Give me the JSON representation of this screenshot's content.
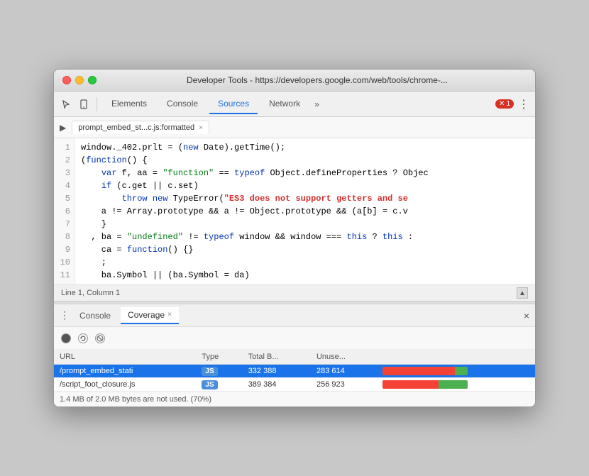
{
  "window": {
    "title": "Developer Tools - https://developers.google.com/web/tools/chrome-..."
  },
  "toolbar": {
    "tabs": [
      {
        "label": "Elements",
        "active": false
      },
      {
        "label": "Console",
        "active": false
      },
      {
        "label": "Sources",
        "active": true
      },
      {
        "label": "Network",
        "active": false
      }
    ],
    "more_tabs_label": "»",
    "error_count": "1",
    "kebab_label": "⋮"
  },
  "file_tab": {
    "name": "prompt_embed_st...c.js:formatted",
    "close_label": "×"
  },
  "code": {
    "lines": [
      {
        "num": "1",
        "text": "window._402.prlt = (new Date).getTime();"
      },
      {
        "num": "2",
        "text": "(function() {"
      },
      {
        "num": "3",
        "text": "    var f, aa = \"function\" == typeof Object.defineProperties ? Objec"
      },
      {
        "num": "4",
        "text": "    if (c.get || c.set)"
      },
      {
        "num": "5",
        "text": "        throw new TypeError(\"ES3 does not support getters and se"
      },
      {
        "num": "6",
        "text": "    a != Array.prototype && a != Object.prototype && (a[b] = c.v"
      },
      {
        "num": "7",
        "text": "    }"
      },
      {
        "num": "8",
        "text": ", ba = \"undefined\" != typeof window && window === this ? this :"
      },
      {
        "num": "9",
        "text": "    ca = function() {}"
      },
      {
        "num": "10",
        "text": "    ;"
      },
      {
        "num": "11",
        "text": "    ba.Symbol || (ba.Symbol = da)"
      }
    ]
  },
  "status_bar": {
    "position": "Line 1, Column 1"
  },
  "bottom_panel": {
    "tabs": [
      {
        "label": "Console",
        "active": false
      },
      {
        "label": "Coverage",
        "active": true
      }
    ],
    "close_label": "×"
  },
  "coverage": {
    "toolbar": {
      "record_tooltip": "Start recording",
      "reload_tooltip": "Reload and start recording",
      "clear_tooltip": "Clear"
    },
    "columns": [
      "URL",
      "Type",
      "Total B...",
      "Unuse..."
    ],
    "rows": [
      {
        "url": "/prompt_embed_stati",
        "type": "JS",
        "total": "332 388",
        "unused": "283 614",
        "unused_pct": 85,
        "used_pct": 15,
        "selected": true
      },
      {
        "url": "/script_foot_closure.js",
        "type": "JS",
        "total": "389 384",
        "unused": "256 923",
        "unused_pct": 66,
        "used_pct": 34,
        "selected": false
      }
    ],
    "footer": "1.4 MB of 2.0 MB bytes are not used. (70%)"
  }
}
